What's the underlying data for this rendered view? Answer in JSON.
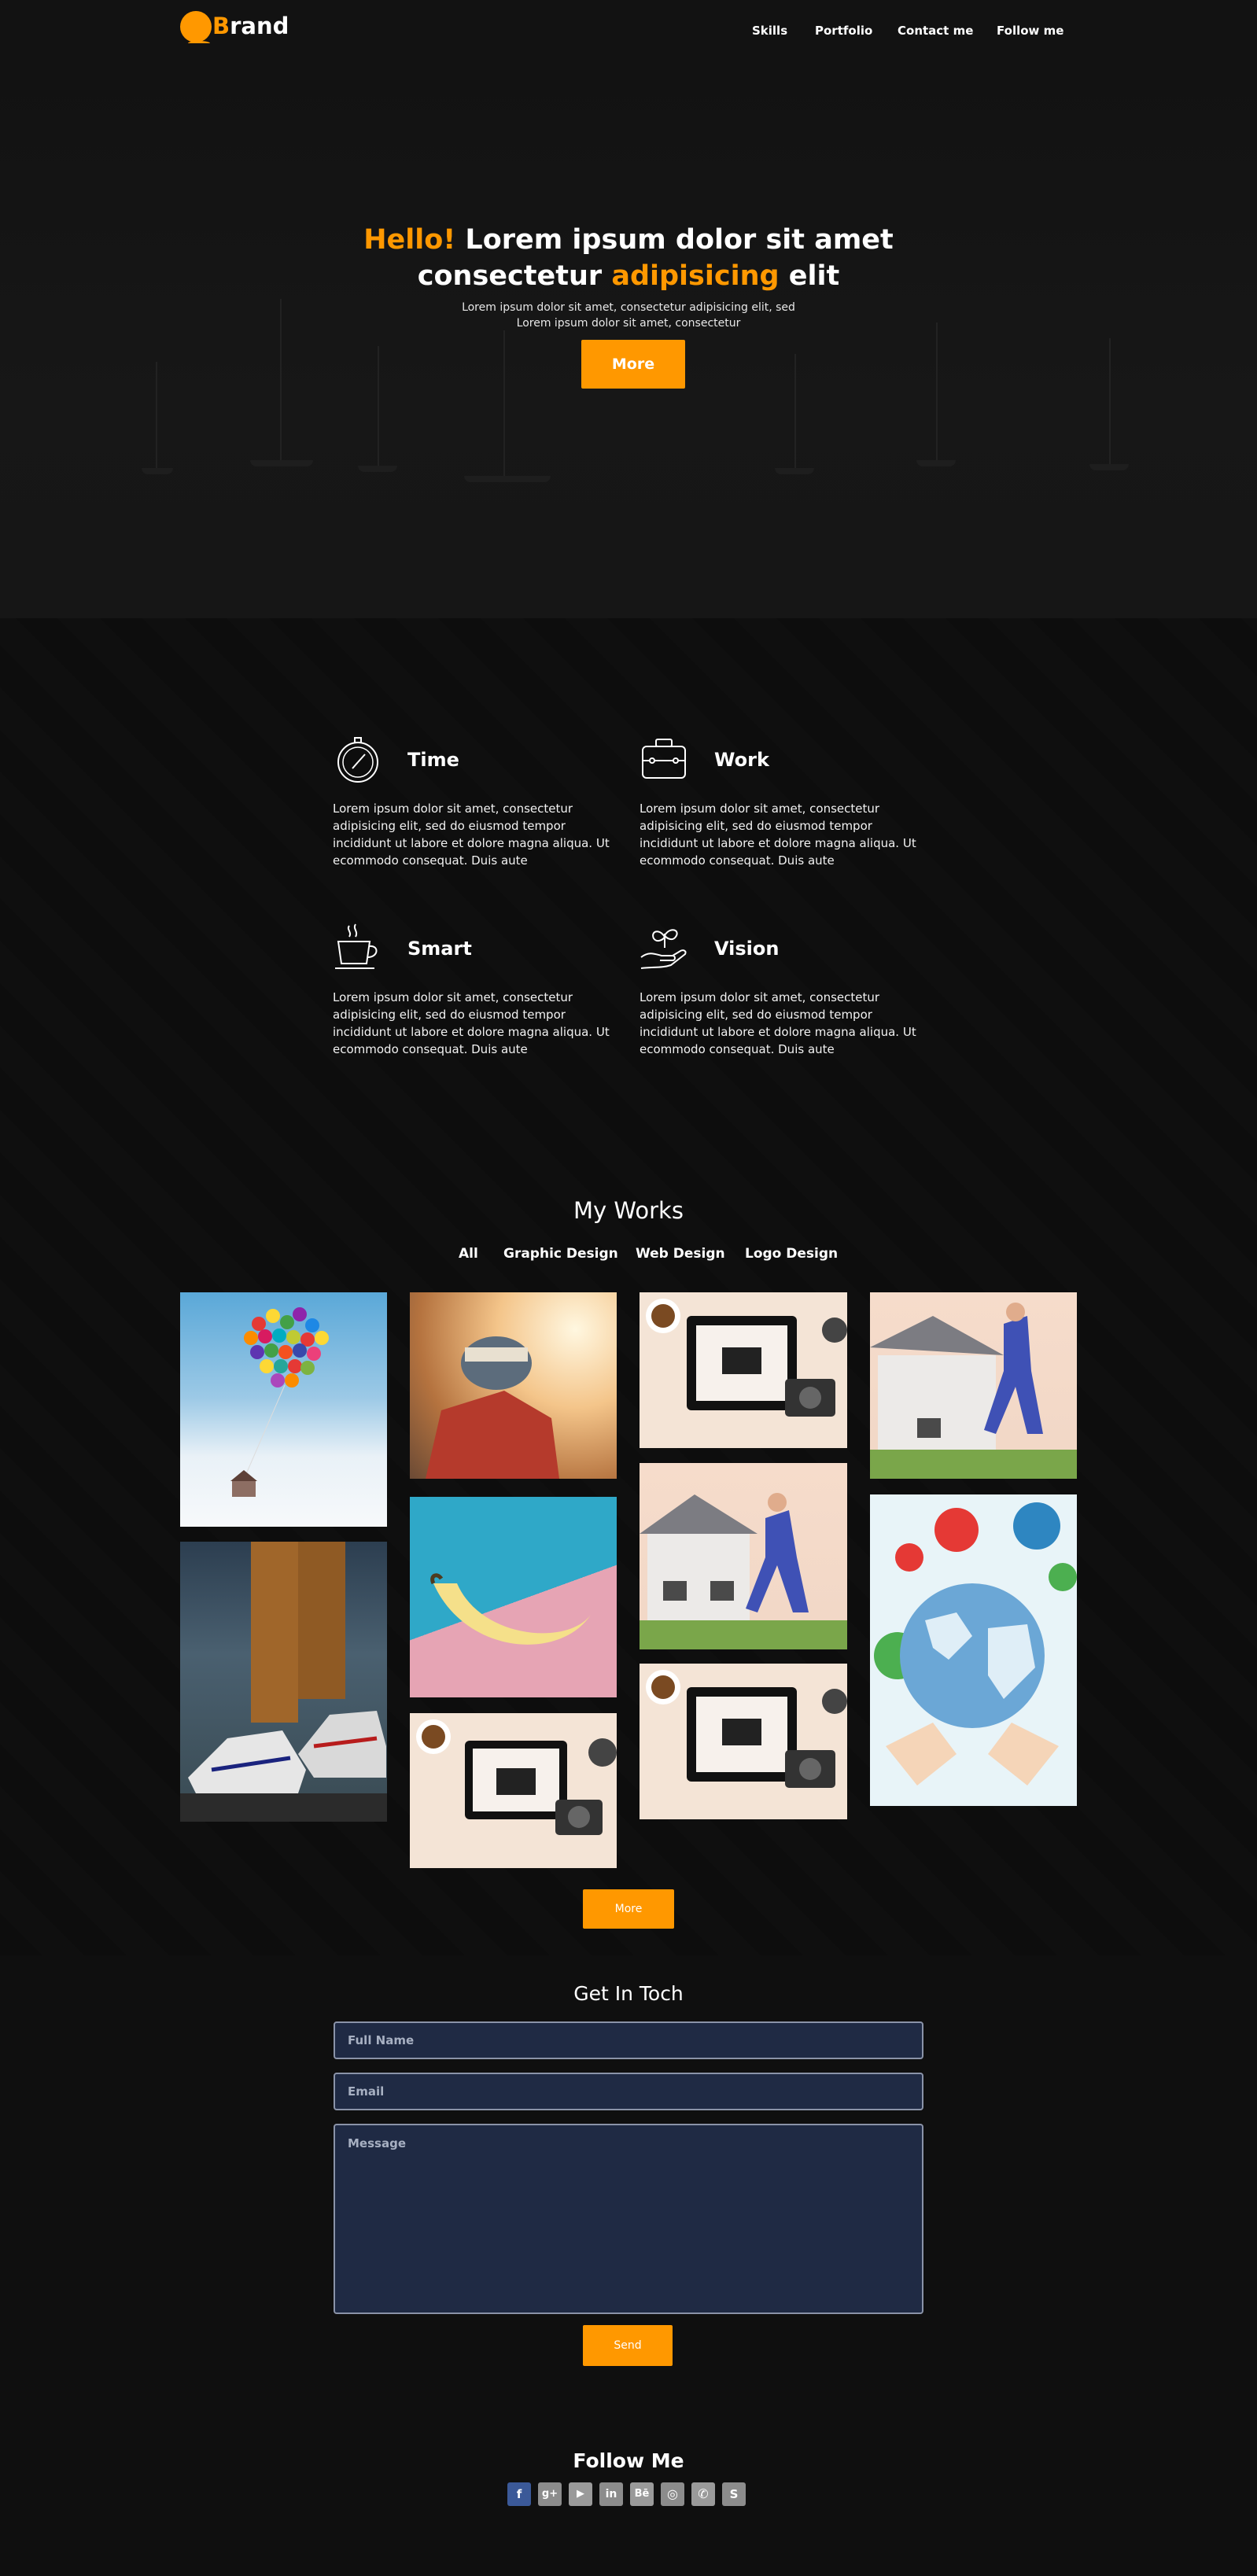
{
  "nav": {
    "brand_first": "B",
    "brand_rest": "rand",
    "links": [
      "Skills",
      "Portfolio",
      "Contact me",
      "Follow me"
    ]
  },
  "hero": {
    "title_hello": "Hello!",
    "title_part1": " Lorem ipsum dolor sit amet",
    "title_part2": "consectetur ",
    "title_highlight": "adipisicing",
    "title_part3": " elit",
    "subtitle_line1": "Lorem ipsum dolor sit amet, consectetur adipisicing elit, sed",
    "subtitle_line2": "Lorem ipsum dolor sit amet, consectetur",
    "button": "More"
  },
  "features": [
    {
      "title": "Time",
      "icon": "stopwatch-icon",
      "text": "Lorem ipsum dolor sit amet, consectetur adipisicing elit, sed do eiusmod tempor incididunt ut labore et dolore magna aliqua. Ut ecommodo consequat. Duis aute"
    },
    {
      "title": "Work",
      "icon": "briefcase-icon",
      "text": "Lorem ipsum dolor sit amet, consectetur adipisicing elit, sed do eiusmod tempor incididunt ut labore et dolore magna aliqua. Ut ecommodo consequat. Duis aute"
    },
    {
      "title": "Smart",
      "icon": "coffee-cup-icon",
      "text": "Lorem ipsum dolor sit amet, consectetur adipisicing elit, sed do eiusmod tempor incididunt ut labore et dolore magna aliqua. Ut ecommodo consequat. Duis aute"
    },
    {
      "title": "Vision",
      "icon": "plant-in-hand-icon",
      "text": "Lorem ipsum dolor sit amet, consectetur adipisicing elit, sed do eiusmod tempor incididunt ut labore et dolore magna aliqua. Ut ecommodo consequat. Duis aute"
    }
  ],
  "works": {
    "title": "My Works",
    "filters": [
      "All",
      "Graphic Design",
      "Web Design",
      "Logo Design"
    ],
    "more_button": "More"
  },
  "contact": {
    "title": "Get In Toch",
    "fullname_placeholder": "Full Name",
    "email_placeholder": "Email",
    "message_placeholder": "Message",
    "send_button": "Send"
  },
  "footer": {
    "title": "Follow Me",
    "social_icons": [
      "facebook-icon",
      "google-plus-icon",
      "youtube-icon",
      "linkedin-icon",
      "behance-icon",
      "dribbble-icon",
      "whatsapp-icon",
      "skype-icon"
    ],
    "social_glyphs": [
      "f",
      "g+",
      "▶",
      "in",
      "Bē",
      "◎",
      "✆",
      "S"
    ]
  },
  "colors": {
    "accent": "#ff9800",
    "background": "#0f0f0f",
    "field_background": "#1f2a44"
  }
}
